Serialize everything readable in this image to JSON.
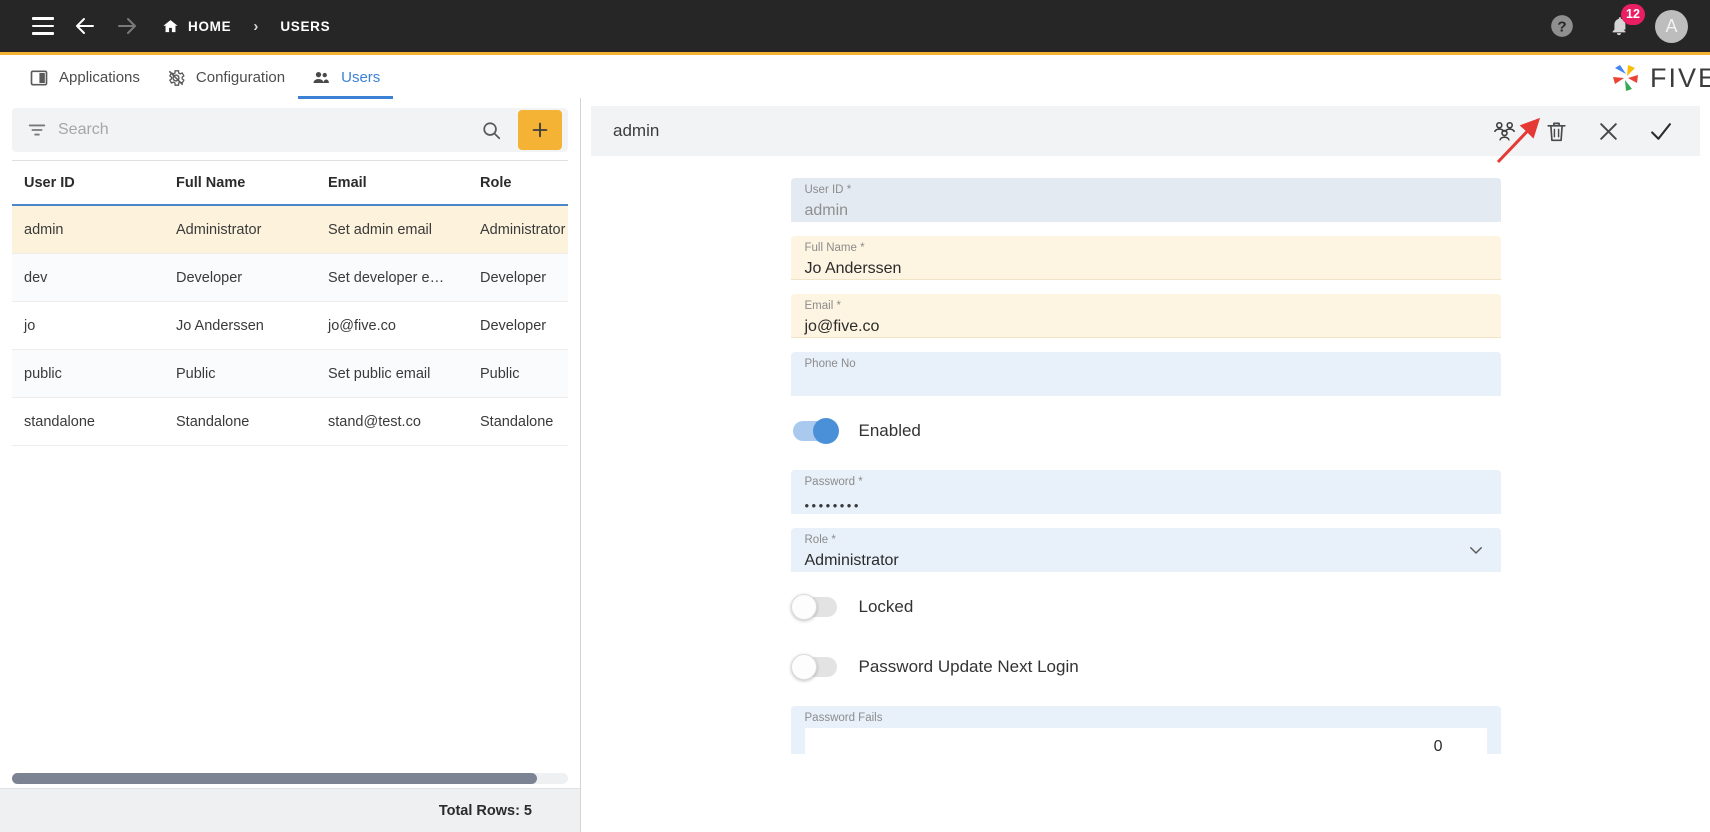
{
  "topbar": {
    "menu_label": "menu",
    "back_label": "back",
    "forward_label": "forward",
    "breadcrumb": [
      "HOME",
      "USERS"
    ],
    "breadcrumb_sep": "›",
    "help_label": "?",
    "notification_count": "12",
    "avatar_initial": "A"
  },
  "tabs": [
    {
      "label": "Applications",
      "icon": "applications-icon",
      "active": false
    },
    {
      "label": "Configuration",
      "icon": "configuration-icon",
      "active": false
    },
    {
      "label": "Users",
      "icon": "users-icon",
      "active": true
    }
  ],
  "brand": {
    "name": "FIVE"
  },
  "search": {
    "placeholder": "Search",
    "value": "",
    "filter_icon": "filter-icon",
    "search_icon": "search-icon",
    "add_label": "+"
  },
  "table": {
    "columns": [
      "User ID",
      "Full Name",
      "Email",
      "Role"
    ],
    "rows": [
      {
        "user_id": "admin",
        "full_name": "Administrator",
        "email": "Set admin email",
        "role": "Administrator",
        "selected": true
      },
      {
        "user_id": "dev",
        "full_name": "Developer",
        "email": "Set developer em…",
        "role": "Developer",
        "selected": false
      },
      {
        "user_id": "jo",
        "full_name": "Jo Anderssen",
        "email": "jo@five.co",
        "role": "Developer",
        "selected": false
      },
      {
        "user_id": "public",
        "full_name": "Public",
        "email": "Set public email",
        "role": "Public",
        "selected": false
      },
      {
        "user_id": "standalone",
        "full_name": "Standalone",
        "email": "stand@test.co",
        "role": "Standalone",
        "selected": false
      }
    ],
    "footer": "Total Rows: 5"
  },
  "detail": {
    "title": "admin",
    "tools": [
      {
        "name": "user-group-icon",
        "label": "Roles"
      },
      {
        "name": "trash-icon",
        "label": "Delete"
      },
      {
        "name": "close-icon",
        "label": "Close"
      },
      {
        "name": "check-icon",
        "label": "Save"
      }
    ],
    "fields": {
      "user_id": {
        "label": "User ID",
        "required": "*",
        "value": "admin",
        "state": "readonly"
      },
      "full_name": {
        "label": "Full Name",
        "required": "*",
        "value": "Jo Anderssen",
        "state": "modified"
      },
      "email": {
        "label": "Email",
        "required": "*",
        "value": "jo@five.co",
        "state": "modified"
      },
      "phone": {
        "label": "Phone No",
        "required": "",
        "value": "",
        "state": "normal"
      },
      "password": {
        "label": "Password",
        "required": "*",
        "value": "••••••••",
        "state": "normal"
      },
      "role": {
        "label": "Role",
        "required": "*",
        "value": "Administrator",
        "state": "normal"
      },
      "password_fails": {
        "label": "Password Fails",
        "required": "",
        "value": "0",
        "state": "normal"
      }
    },
    "toggles": {
      "enabled": {
        "label": "Enabled",
        "on": true
      },
      "locked": {
        "label": "Locked",
        "on": false
      },
      "password_update": {
        "label": "Password Update Next Login",
        "on": false
      }
    }
  },
  "colors": {
    "topbar_bg": "#262626",
    "accent_gold": "#f5b335",
    "accent_blue": "#3b82d6",
    "badge_pink": "#e91e63",
    "field_blue": "#e8f0fa",
    "field_amber": "#fdf4e1",
    "row_selected": "#fdf3dd",
    "annotation_red": "#e53935"
  }
}
